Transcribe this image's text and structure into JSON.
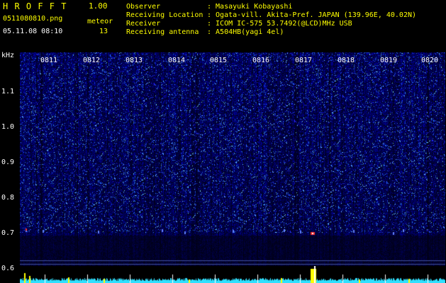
{
  "header": {
    "app_name": "H R O F F T",
    "version": "1.00",
    "file_name": "0511080810.png",
    "date_time": "05.11.08 08:10",
    "meteor_label": "meteor",
    "meteor_count": "13"
  },
  "info": {
    "observer_key": "Observer",
    "observer_val": ": Masayuki Kobayashi",
    "location_key": "Receiving Location",
    "location_val": ": Ogata-vill. Akita-Pref. JAPAN (139.96E, 40.02N)",
    "receiver_key": "Receiver",
    "receiver_val": ": ICOM IC-575 53.7492(@LCD)MHz USB",
    "antenna_key": "Receiving antenna",
    "antenna_val": ": A504HB(yagi 4el)"
  },
  "axis": {
    "unit": "kHz",
    "y_ticks": [
      "1.1",
      "1.0",
      "0.9",
      "0.8",
      "0.7",
      "0.6"
    ],
    "time_ticks": [
      "0811",
      "0812",
      "0813",
      "0814",
      "0815",
      "0816",
      "0817",
      "0818",
      "0819",
      "0820"
    ]
  },
  "colors": {
    "background": "#000000",
    "label_yellow": "#ffff00",
    "spectrum_low": "#000a3c",
    "spectrum_high": "#3c82ff",
    "meteor_echo": "#ff3030",
    "signal_strip": "#2fe0ff"
  }
}
